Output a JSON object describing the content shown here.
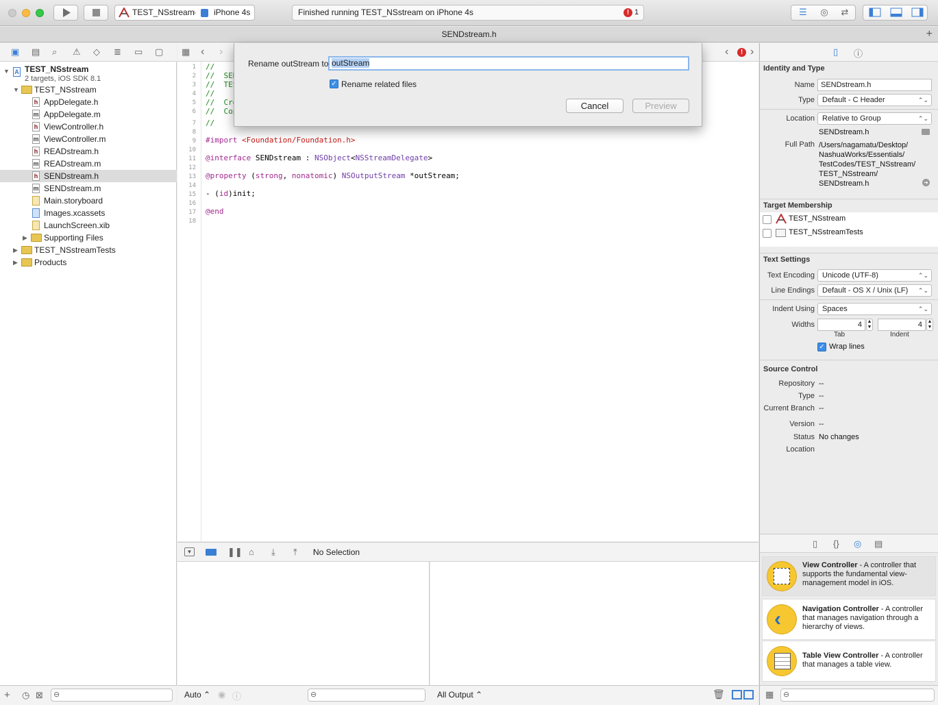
{
  "toolbar": {
    "scheme": "TEST_NSstream",
    "device": "iPhone 4s",
    "status": "Finished running TEST_NSstream on iPhone 4s",
    "issue_count": "1"
  },
  "tab": {
    "title": "SENDstream.h"
  },
  "navigator": {
    "project": {
      "name": "TEST_NSstream",
      "subtitle": "2 targets, iOS SDK 8.1"
    },
    "group": "TEST_NSstream",
    "files": [
      {
        "name": "AppDelegate.h",
        "kind": "h"
      },
      {
        "name": "AppDelegate.m",
        "kind": "m"
      },
      {
        "name": "ViewController.h",
        "kind": "h"
      },
      {
        "name": "ViewController.m",
        "kind": "m"
      },
      {
        "name": "READstream.h",
        "kind": "h"
      },
      {
        "name": "READstream.m",
        "kind": "m"
      },
      {
        "name": "SENDstream.h",
        "kind": "h"
      },
      {
        "name": "SENDstream.m",
        "kind": "m"
      },
      {
        "name": "Main.storyboard",
        "kind": "storyboard"
      },
      {
        "name": "Images.xcassets",
        "kind": "assets"
      },
      {
        "name": "LaunchScreen.xib",
        "kind": "xib"
      }
    ],
    "supporting": "Supporting Files",
    "tests": "TEST_NSstreamTests",
    "products": "Products"
  },
  "editor": {
    "line_numbers": [
      "1",
      "2",
      "3",
      "4",
      "5",
      "6",
      "7",
      "8",
      "9",
      "10",
      "11",
      "12",
      "13",
      "14",
      "15",
      "16",
      "17",
      "18"
    ],
    "lines": {
      "l1": "//",
      "l2": "//  SEN",
      "l3": "//  TES",
      "l4": "//",
      "l5": "//  Cre",
      "l6": "//  Cop",
      "l7": "//",
      "l9a": "#import ",
      "l9b": "<Foundation/Foundation.h>",
      "l11a": "@interface",
      "l11b": " SENDstream : ",
      "l11c": "NSObject",
      "l11d": "<",
      "l11e": "NSStreamDelegate",
      "l11f": ">",
      "l13a": "@property",
      "l13b": " (",
      "l13c": "strong",
      "l13d": ", ",
      "l13e": "nonatomic",
      "l13f": ") ",
      "l13g": "NSOutputStream",
      "l13h": " *outStream;",
      "l15a": "- (",
      "l15b": "id",
      "l15c": ")init;",
      "l17": "@end"
    }
  },
  "dialog": {
    "label": "Rename outStream to",
    "value": "outStream",
    "checkbox_label": "Rename related files",
    "cancel": "Cancel",
    "preview": "Preview"
  },
  "debug": {
    "no_selection": "No Selection",
    "auto": "Auto",
    "all_output": "All Output"
  },
  "inspector": {
    "identity_title": "Identity and Type",
    "name_label": "Name",
    "name_value": "SENDstream.h",
    "type_label": "Type",
    "type_value": "Default - C Header",
    "location_label": "Location",
    "location_value": "Relative to Group",
    "location_file": "SENDstream.h",
    "fullpath_label": "Full Path",
    "fullpath_lines": [
      "/Users/nagamatu/Desktop/",
      "NashuaWorks/Essentials/",
      "TestCodes/TEST_NSstream/",
      "TEST_NSstream/",
      "SENDstream.h"
    ],
    "target_title": "Target Membership",
    "targets": [
      "TEST_NSstream",
      "TEST_NSstreamTests"
    ],
    "text_title": "Text Settings",
    "encoding_label": "Text Encoding",
    "encoding_value": "Unicode (UTF-8)",
    "endings_label": "Line Endings",
    "endings_value": "Default - OS X / Unix (LF)",
    "indent_label": "Indent Using",
    "indent_value": "Spaces",
    "widths_label": "Widths",
    "tab_value": "4",
    "indent_width_value": "4",
    "tab_caption": "Tab",
    "indent_caption": "Indent",
    "wrap_label": "Wrap lines",
    "sc_title": "Source Control",
    "repo_label": "Repository",
    "repo_value": "--",
    "sc_type_label": "Type",
    "sc_type_value": "--",
    "branch_label": "Current Branch",
    "branch_value": "--",
    "version_label": "Version",
    "version_value": "--",
    "status_label": "Status",
    "status_value": "No changes",
    "sc_location_label": "Location"
  },
  "library": [
    {
      "title": "View Controller",
      "desc": " - A controller that supports the fundamental view-management model in iOS."
    },
    {
      "title": "Navigation Controller",
      "desc": " - A controller that manages navigation through a hierarchy of views."
    },
    {
      "title": "Table View Controller",
      "desc": " - A controller that manages a table view."
    }
  ]
}
